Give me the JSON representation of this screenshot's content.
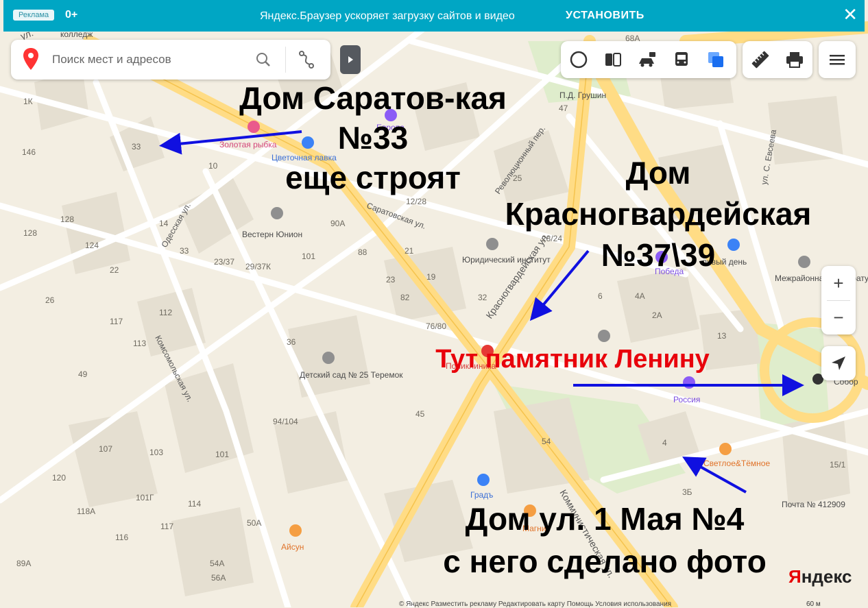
{
  "banner": {
    "ad_tag": "Реклама",
    "age": "0+",
    "text": "Яндекс.Браузер ускоряет загрузку сайтов и видео",
    "install": "УСТАНОВИТЬ",
    "close_icon": "close-icon"
  },
  "search": {
    "placeholder": "Поиск мест и адресов",
    "icons": [
      "map-pin-icon",
      "search-icon",
      "route-icon",
      "collapse-panel-icon"
    ]
  },
  "toolbar": {
    "layers": [
      "panorama-icon",
      "transport-icon",
      "traffic-camera-icon",
      "bus-icon",
      "layers-icon"
    ],
    "tools": [
      "ruler-icon",
      "print-icon"
    ],
    "menu": "hamburger-icon"
  },
  "zoom": {
    "plus": "+",
    "minus": "−"
  },
  "colors": {
    "banner": "#00a6c4",
    "map_background": "#f3eee2",
    "block": "#e9e3d6",
    "major_road": "#ffdc85",
    "park": "#dfedcc",
    "arrow": "#1010e0",
    "highlight": "#e8000b"
  },
  "map": {
    "streets": [
      {
        "name": "Саратовская ул."
      },
      {
        "name": "Красногвардейская ул."
      },
      {
        "name": "Комсомольская ул."
      },
      {
        "name": "Одесская ул."
      },
      {
        "name": "Революционный пер."
      },
      {
        "name": "ул. С. Евсеева"
      },
      {
        "name": "Коммунистическая ул."
      },
      {
        "name": "ул."
      }
    ],
    "pois": [
      {
        "name": "колледж"
      },
      {
        "name": "Золотая рыбка"
      },
      {
        "name": "Цветочная лавка"
      },
      {
        "name": "Европа"
      },
      {
        "name": "П.Д. Грушин"
      },
      {
        "name": "Вестерн Юнион"
      },
      {
        "name": "Юридический институт"
      },
      {
        "name": "Победа"
      },
      {
        "name": "Межрайонная прокуратура"
      },
      {
        "name": "Детский сад № 25 Теремок"
      },
      {
        "name": "Поликлиника"
      },
      {
        "name": "Россия"
      },
      {
        "name": "Собор"
      },
      {
        "name": "Светлое&Тёмное"
      },
      {
        "name": "Градъ"
      },
      {
        "name": "Магнит"
      },
      {
        "name": "Айсун"
      },
      {
        "name": "Почта № 412909"
      },
      {
        "name": "ливый день"
      }
    ],
    "house_numbers": [
      {
        "text": "1К"
      },
      {
        "text": "146"
      },
      {
        "text": "33"
      },
      {
        "text": "10"
      },
      {
        "text": "128"
      },
      {
        "text": "128"
      },
      {
        "text": "14"
      },
      {
        "text": "124"
      },
      {
        "text": "33"
      },
      {
        "text": "22"
      },
      {
        "text": "26"
      },
      {
        "text": "117"
      },
      {
        "text": "113"
      },
      {
        "text": "49"
      },
      {
        "text": "112"
      },
      {
        "text": "23/37"
      },
      {
        "text": "29/37К"
      },
      {
        "text": "101"
      },
      {
        "text": "90А"
      },
      {
        "text": "88"
      },
      {
        "text": "23"
      },
      {
        "text": "82"
      },
      {
        "text": "21"
      },
      {
        "text": "19"
      },
      {
        "text": "32"
      },
      {
        "text": "76/80"
      },
      {
        "text": "36"
      },
      {
        "text": "94/104"
      },
      {
        "text": "101"
      },
      {
        "text": "103"
      },
      {
        "text": "107"
      },
      {
        "text": "120"
      },
      {
        "text": "118А"
      },
      {
        "text": "116"
      },
      {
        "text": "114"
      },
      {
        "text": "101Г"
      },
      {
        "text": "117"
      },
      {
        "text": "50А"
      },
      {
        "text": "54А"
      },
      {
        "text": "56А"
      },
      {
        "text": "89А"
      },
      {
        "text": "45"
      },
      {
        "text": "54"
      },
      {
        "text": "47"
      },
      {
        "text": "28/24"
      },
      {
        "text": "12/28"
      },
      {
        "text": "25"
      },
      {
        "text": "68А"
      },
      {
        "text": "6"
      },
      {
        "text": "4А"
      },
      {
        "text": "2А"
      },
      {
        "text": "13"
      },
      {
        "text": "4"
      },
      {
        "text": "15/1"
      },
      {
        "text": "3Б"
      }
    ]
  },
  "annotations": {
    "saratovskaya": [
      "Дом Саратов-кая",
      "№33",
      "еще строят"
    ],
    "krasnogvard": [
      "Дом",
      "Красногвардейская",
      "№37\\39"
    ],
    "lenin": "Тут памятник Ленину",
    "may": [
      "Дом ул. 1 Мая №4",
      "с него сделано фото"
    ]
  },
  "footer": {
    "copyright": "© Яндекс   Разместить рекламу   Редактировать карту   Помощь   Условия использования",
    "scale": "60 м",
    "logo_y": "Я",
    "logo_rest": "ндекс"
  }
}
